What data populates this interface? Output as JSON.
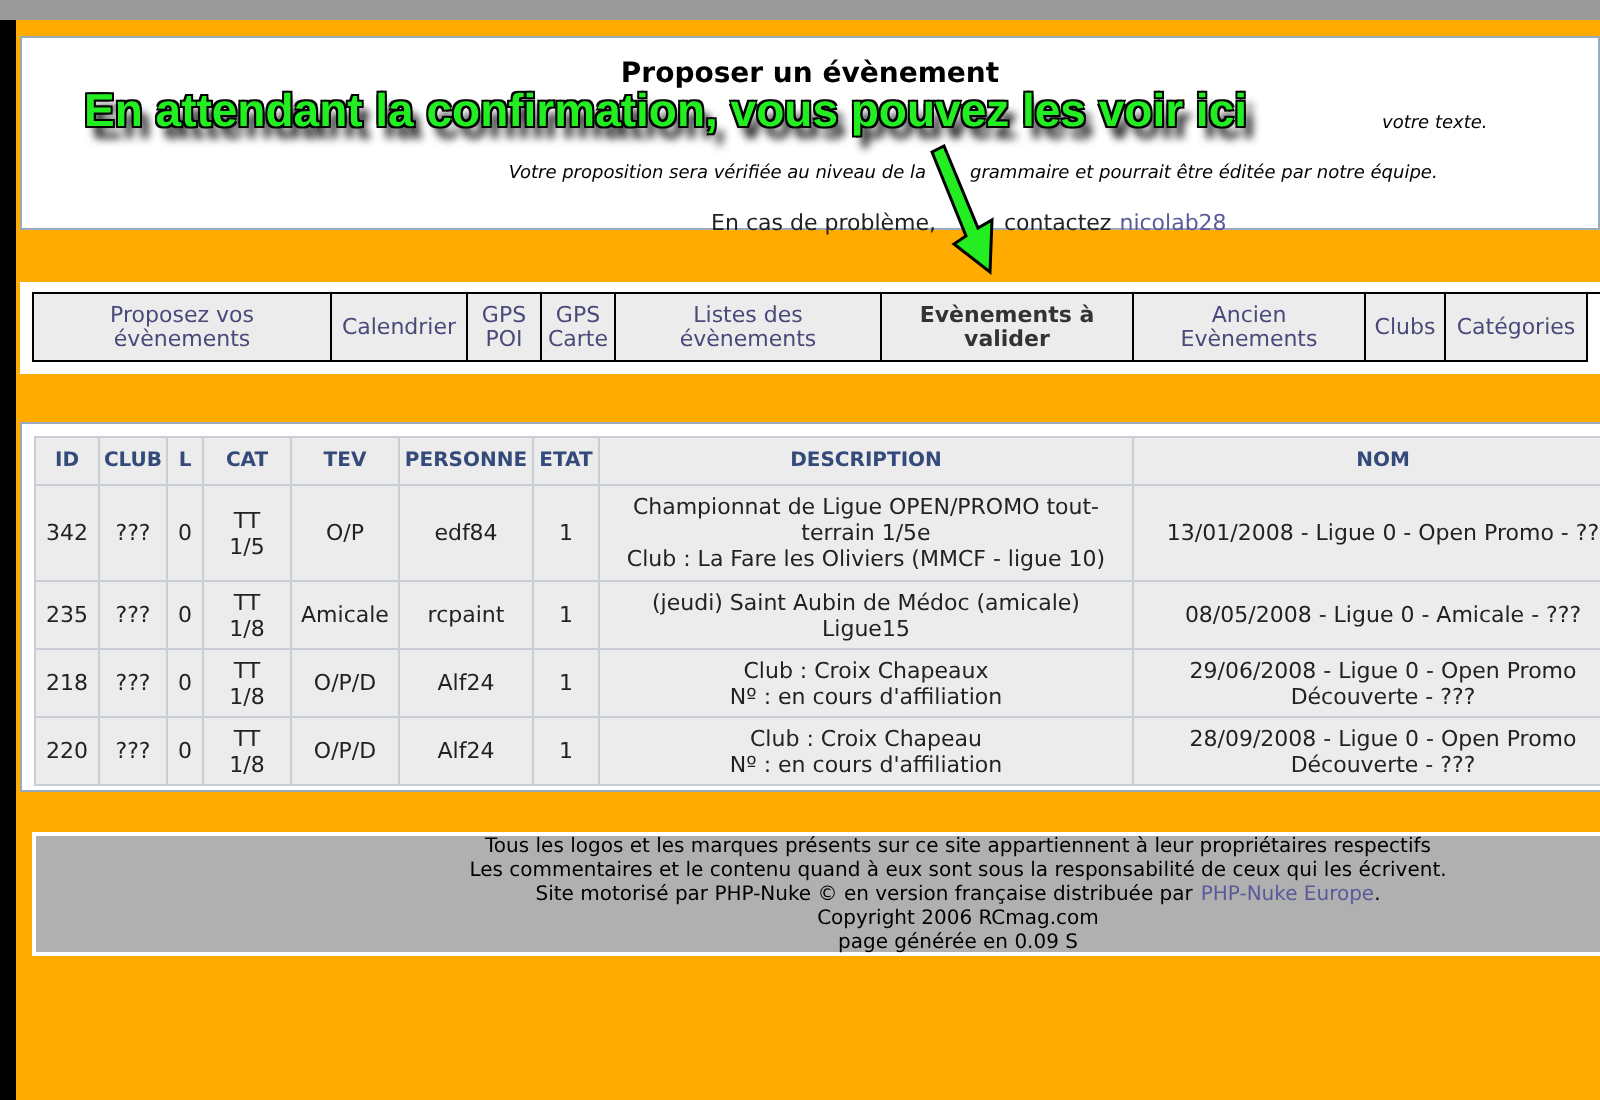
{
  "header": {
    "title": "Proposer un évènement",
    "fragment": "votre texte.",
    "note": [
      "Votre proposition sera vérifiée au niveau de la",
      "grammaire et pourrait être éditée par notre équipe."
    ],
    "contact_label": [
      "En cas de problème,",
      "contactez"
    ],
    "contact_link": "nicolab28"
  },
  "overlay": {
    "caption": "En attendant la confirmation, vous pouvez les voir ici"
  },
  "nav": [
    {
      "label": "Proposez vos évènements",
      "selected": false
    },
    {
      "label": "Calendrier",
      "selected": false
    },
    {
      "label": "GPS POI",
      "selected": false
    },
    {
      "label": "GPS Carte",
      "selected": false
    },
    {
      "label": "Listes des évènements",
      "selected": false
    },
    {
      "label": "Evènements à valider",
      "selected": true
    },
    {
      "label": "Ancien Evènements",
      "selected": false
    },
    {
      "label": "Clubs",
      "selected": false
    },
    {
      "label": "Catégories",
      "selected": false
    }
  ],
  "table": {
    "columns": [
      "ID",
      "CLUB",
      "L",
      "CAT",
      "TEV",
      "PERSONNE",
      "ETAT",
      "DESCRIPTION",
      "NOM"
    ],
    "rows": [
      {
        "id": "342",
        "club": "???",
        "l": "0",
        "cat": [
          "TT",
          "1/5"
        ],
        "tev": "O/P",
        "personne": "edf84",
        "etat": "1",
        "description": [
          "Championnat de Ligue OPEN/PROMO tout-terrain 1/5e",
          "Club : La Fare les Oliviers (MMCF - ligue 10)"
        ],
        "nom": "13/01/2008 - Ligue 0 - Open Promo - ??"
      },
      {
        "id": "235",
        "club": "???",
        "l": "0",
        "cat": [
          "TT",
          "1/8"
        ],
        "tev": "Amicale",
        "personne": "rcpaint",
        "etat": "1",
        "description": [
          "(jeudi) Saint Aubin de Médoc (amicale) Ligue15"
        ],
        "nom": "08/05/2008 - Ligue 0 - Amicale - ???"
      },
      {
        "id": "218",
        "club": "???",
        "l": "0",
        "cat": [
          "TT",
          "1/8"
        ],
        "tev": "O/P/D",
        "personne": "Alf24",
        "etat": "1",
        "description": [
          "Club : Croix Chapeaux",
          "Nº : en cours d'affiliation"
        ],
        "nom": "29/06/2008 - Ligue 0 - Open Promo Découverte - ???"
      },
      {
        "id": "220",
        "club": "???",
        "l": "0",
        "cat": [
          "TT",
          "1/8"
        ],
        "tev": "O/P/D",
        "personne": "Alf24",
        "etat": "1",
        "description": [
          "Club : Croix Chapeau",
          "Nº : en cours d'affiliation"
        ],
        "nom": "28/09/2008 - Ligue 0 - Open Promo Découverte - ???"
      }
    ]
  },
  "footer": {
    "lines": [
      "Tous les logos et les marques présents sur ce site appartiennent à leur propriétaires respectifs",
      "Les commentaires et le contenu quand à eux sont sous la responsabilité de ceux qui les écrivent."
    ],
    "powered_prefix": "Site motorisé par PHP-Nuke © en version française distribuée par",
    "powered_link": "PHP-Nuke Europe",
    "powered_suffix": ".",
    "copyright": "Copyright 2006 RCmag.com",
    "generated": "page générée en 0.09 S"
  }
}
